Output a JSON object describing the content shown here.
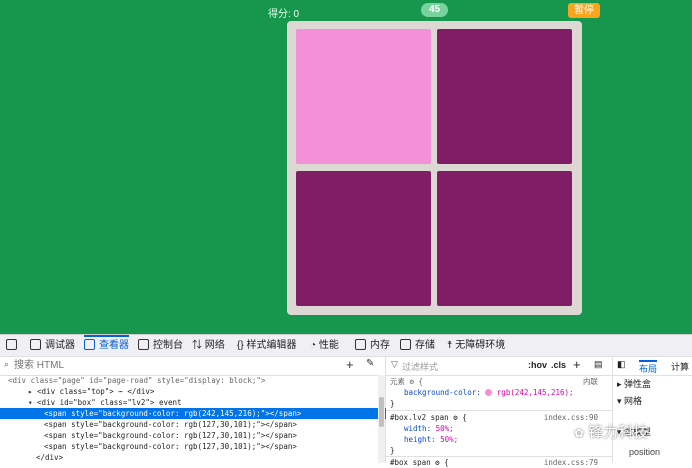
{
  "game": {
    "score_label": "得分: 0",
    "timer": "45",
    "pause_label": "暂停",
    "cells": [
      {
        "color": "#f291d8"
      },
      {
        "color": "#7f1e65"
      },
      {
        "color": "#7f1e65"
      },
      {
        "color": "#7f1e65"
      }
    ]
  },
  "devtools": {
    "tabs": [
      "调试器",
      "查看器",
      "控制台",
      "网络",
      "样式编辑器",
      "性能",
      "内存",
      "存储",
      "无障碍环境"
    ],
    "search_placeholder": "搜索 HTML",
    "markup": [
      "<div class=\"page\" id=\"page-road\" style=\"display: block;\">",
      "▸ <div class=\"top\"> ⋯ </div>",
      "▾ <div id=\"box\" class=\"lv2\"> event",
      "<span style=\"background-color: rgb(242,145,216);\"></span>",
      "<span style=\"background-color: rgb(127,30,101);\"></span>",
      "<span style=\"background-color: rgb(127,30,101);\"></span>",
      "<span style=\"background-color: rgb(127,30,101);\"></span>",
      "</div>"
    ],
    "filter_placeholder": "过滤样式",
    "hov": ":hov",
    "cls": ".cls",
    "rules": {
      "element_label": "元素 ⚙ {",
      "element_prop": "background-color:",
      "element_val": "rgb(242,145,216);",
      "inline": "内联",
      "close": "}",
      "rule2_sel": "#box.lv2 span ⚙ {",
      "rule2_src": "index.css:90",
      "rule2_width_prop": "width:",
      "rule2_width_val": "50%;",
      "rule2_height_prop": "height:",
      "rule2_height_val": "50%;",
      "rule3_sel": "#box span ⚙ {",
      "rule3_src": "index.css:79"
    },
    "layout_tabs": [
      "布局",
      "计算"
    ],
    "layout_items": [
      "弹性盒",
      "网格",
      "盒模型",
      "position"
    ],
    "watermark": "锋力科技"
  }
}
